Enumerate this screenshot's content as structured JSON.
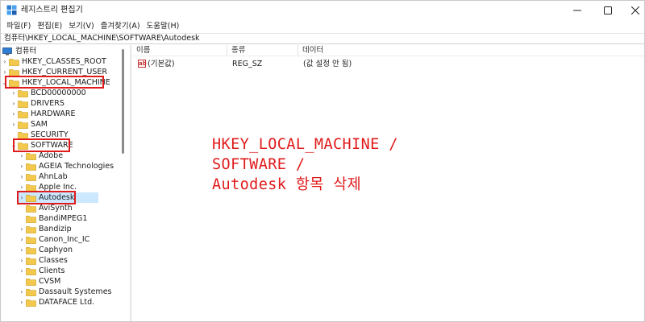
{
  "window": {
    "title": "레지스트리 편집기",
    "controls": {
      "minimize": "—",
      "maximize": "☐",
      "close": "✕"
    }
  },
  "menu": [
    "파일(F)",
    "편집(E)",
    "보기(V)",
    "즐겨찾기(A)",
    "도움말(H)"
  ],
  "address": "컴퓨터\\HKEY_LOCAL_MACHINE\\SOFTWARE\\Autodesk",
  "tree": {
    "root": "컴퓨터",
    "items": [
      "HKEY_CLASSES_ROOT",
      "HKEY_CURRENT_USER",
      "HKEY_LOCAL_MACHINE",
      "BCD00000000",
      "DRIVERS",
      "HARDWARE",
      "SAM",
      "SECURITY",
      "SOFTWARE",
      "Adobe",
      "AGEIA Technologies",
      "AhnLab",
      "Apple Inc.",
      "Autodesk",
      "AviSynth",
      "BandiMPEG1",
      "Bandizip",
      "Canon_Inc_IC",
      "Caphyon",
      "Classes",
      "Clients",
      "CVSM",
      "Dassault Systemes",
      "DATAFACE Ltd."
    ]
  },
  "list": {
    "columns": [
      "이름",
      "종류",
      "데이터"
    ],
    "rows": [
      {
        "name": "(기본값)",
        "type": "REG_SZ",
        "data": "(값 설정 안 됨)"
      }
    ]
  },
  "annotation": {
    "line1": "HKEY_LOCAL_MACHINE /",
    "line2": "SOFTWARE /",
    "line3": "Autodesk 항목 삭제",
    "color": "#e01b1b"
  },
  "colors": {
    "folder": "#f2c94c",
    "highlight": "#e01b1b",
    "selection": "#cce8ff"
  }
}
